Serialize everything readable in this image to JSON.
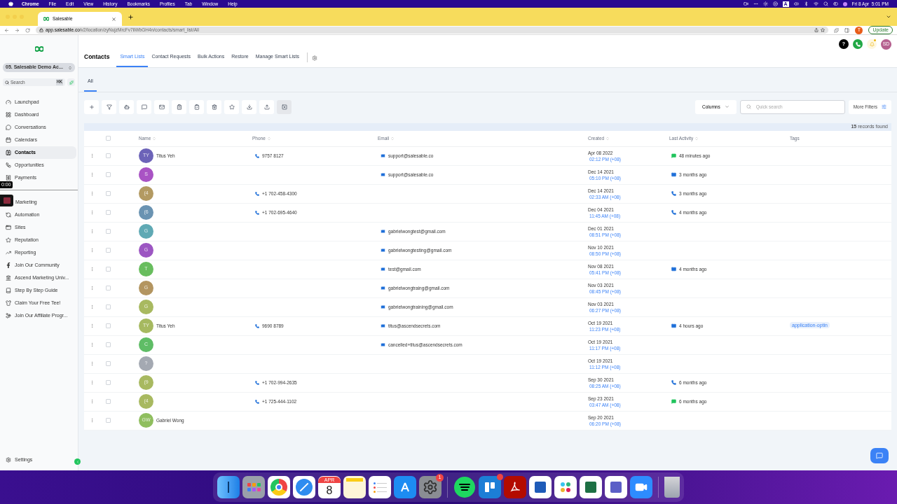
{
  "menubar": {
    "app": "Chrome",
    "menus": [
      "File",
      "Edit",
      "View",
      "History",
      "Bookmarks",
      "Profiles",
      "Tab",
      "Window",
      "Help"
    ],
    "input_source": "A",
    "clock": "Fri 8 Apr  5:01 PM"
  },
  "browser": {
    "tab_title": "Salesable",
    "url_host": "app.salesable.co",
    "url_path": "/v2/location/zyNujzMrcFv7iiWbGH4n/contacts/smart_list/All",
    "profile_initial": "T",
    "update_label": "Update"
  },
  "sidebar": {
    "account": "05. Salesable Demo Ac...",
    "search_placeholder": "Search",
    "shortcut": "⌘K",
    "recording_timer": "0:00",
    "settings": "Settings",
    "groups": [
      {
        "items": [
          {
            "label": "Launchpad",
            "selected": false
          },
          {
            "label": "Dashboard",
            "selected": false
          },
          {
            "label": "Conversations",
            "selected": false
          },
          {
            "label": "Calendars",
            "selected": false
          },
          {
            "label": "Contacts",
            "selected": true
          },
          {
            "label": "Opportunities",
            "selected": false
          },
          {
            "label": "Payments",
            "selected": false
          }
        ]
      },
      {
        "items": [
          {
            "label": "Marketing",
            "selected": false
          },
          {
            "label": "Automation",
            "selected": false
          },
          {
            "label": "Sites",
            "selected": false
          },
          {
            "label": "Reputation",
            "selected": false
          },
          {
            "label": "Reporting",
            "selected": false
          },
          {
            "label": "Join Our Community",
            "selected": false
          },
          {
            "label": "Ascend Marketing Univ...",
            "selected": false
          },
          {
            "label": "Step By Step Guide",
            "selected": false
          },
          {
            "label": "Claim Your Free Tee!",
            "selected": false
          },
          {
            "label": "Join Our Affiliate Progr...",
            "selected": false
          }
        ]
      }
    ]
  },
  "header": {
    "title": "Contacts",
    "help": "?",
    "avatar": "SD",
    "tabs": [
      {
        "label": "Smart Lists",
        "selected": true
      },
      {
        "label": "Contact Requests",
        "selected": false
      },
      {
        "label": "Bulk Actions",
        "selected": false
      },
      {
        "label": "Restore",
        "selected": false
      },
      {
        "label": "Manage Smart Lists",
        "selected": false
      }
    ]
  },
  "list_tabs": [
    {
      "label": "All",
      "selected": true
    }
  ],
  "toolbar": {
    "columns_label": "Columns",
    "search_placeholder": "Quick search",
    "more_filters": "More Filters",
    "records_count": "15",
    "records_label": "records found"
  },
  "table": {
    "all_checked": false,
    "columns": [
      "Name",
      "Phone",
      "Email",
      "Created",
      "Last Activity",
      "Tags"
    ],
    "rows": [
      {
        "initials": "TY",
        "color": "#6c63b8",
        "name": "Titus Yeh",
        "phone": "9757 8127",
        "email": "support@salesable.co",
        "date": "Apr 08 2022",
        "time": "02:12 PM",
        "tz": "(+08)",
        "activity": {
          "kind": "sms",
          "label": "48 minutes ago"
        },
        "checked": false
      },
      {
        "initials": "S",
        "color": "#a953c4",
        "email": "support@salesable.co",
        "date": "Dec 14 2021",
        "time": "05:10 PM",
        "tz": "(+08)",
        "activity": {
          "kind": "email",
          "label": "3 months ago"
        },
        "checked": false
      },
      {
        "initials": "(4",
        "color": "#b39a62",
        "phone": "+1 702-458-4300",
        "date": "Dec 14 2021",
        "time": "02:33 AM",
        "tz": "(+08)",
        "activity": {
          "kind": "call",
          "label": "3 months ago"
        },
        "checked": false
      },
      {
        "initials": "(6",
        "color": "#6a93b2",
        "phone": "+1 702-695-4640",
        "date": "Dec 04 2021",
        "time": "11:45 AM",
        "tz": "(+08)",
        "activity": {
          "kind": "call",
          "label": "4 months ago"
        },
        "checked": false
      },
      {
        "initials": "G",
        "color": "#5fa9b4",
        "email": "gabrielwongtest@gmail.com",
        "date": "Dec 01 2021",
        "time": "08:51 PM",
        "tz": "(+08)",
        "checked": false
      },
      {
        "initials": "G",
        "color": "#9c56c2",
        "email": "gabrielwongtesting@gmail.com",
        "date": "Nov 10 2021",
        "time": "08:50 PM",
        "tz": "(+08)",
        "checked": false
      },
      {
        "initials": "T",
        "color": "#68bd5e",
        "email": "test@gmail.com",
        "date": "Nov 08 2021",
        "time": "05:41 PM",
        "tz": "(+08)",
        "activity": {
          "kind": "email",
          "label": "4 months ago"
        },
        "checked": false
      },
      {
        "initials": "G",
        "color": "#b39560",
        "email": "gabrielwongtraing@gmail.com",
        "date": "Nov 03 2021",
        "time": "08:45 PM",
        "tz": "(+08)",
        "checked": false
      },
      {
        "initials": "G",
        "color": "#a8b960",
        "email": "gabrielwongtraining@gmail.com",
        "date": "Nov 03 2021",
        "time": "06:27 PM",
        "tz": "(+08)",
        "checked": false
      },
      {
        "initials": "TY",
        "color": "#a6b960",
        "name": "Titus Yeh",
        "phone": "9690 8789",
        "email": "titus@ascendsecrets.com",
        "date": "Oct 19 2021",
        "time": "11:23 PM",
        "tz": "(+08)",
        "activity": {
          "kind": "email",
          "label": "4 hours ago"
        },
        "tag": "application-optin",
        "checked": false
      },
      {
        "initials": "C",
        "color": "#5fbd66",
        "email": "cancelled+titus@ascendsecrets.com",
        "date": "Oct 19 2021",
        "time": "11:17 PM",
        "tz": "(+08)",
        "checked": false
      },
      {
        "initials": "?",
        "color": "#a4a9b2",
        "date": "Oct 19 2021",
        "time": "11:12 PM",
        "tz": "(+08)",
        "checked": false
      },
      {
        "initials": "(9",
        "color": "#a8b960",
        "phone": "+1 702-994-2635",
        "date": "Sep 30 2021",
        "time": "08:25 AM",
        "tz": "(+08)",
        "activity": {
          "kind": "call",
          "label": "6 months ago"
        },
        "checked": false
      },
      {
        "initials": "(4",
        "color": "#a8b960",
        "phone": "+1 725-444-1102",
        "date": "Sep 23 2021",
        "time": "03:47 AM",
        "tz": "(+08)",
        "activity": {
          "kind": "sms",
          "label": "6 months ago"
        },
        "checked": false
      },
      {
        "initials": "GW",
        "color": "#8fbe5e",
        "name": "Gabriel Wong",
        "date": "Sep 20 2021",
        "time": "06:20 PM",
        "tz": "(+08)",
        "checked": false
      }
    ]
  },
  "dock": {
    "calendar_month": "APR",
    "calendar_day": "8",
    "settings_badge": "1"
  }
}
